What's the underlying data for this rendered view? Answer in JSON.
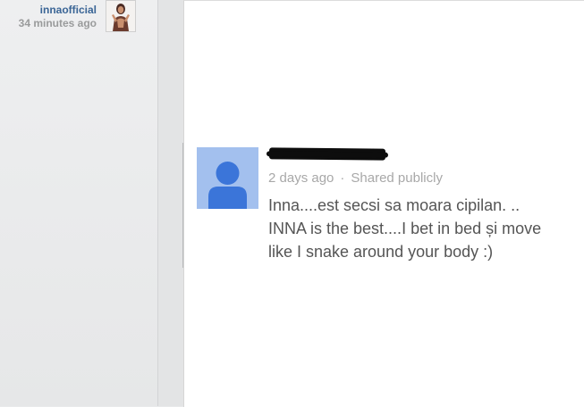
{
  "stream_item": {
    "author_name": "innaofficial",
    "time_ago": "34 minutes ago"
  },
  "comment": {
    "meta_time": "2 days ago",
    "meta_separator": "·",
    "meta_visibility": "Shared publicly",
    "body_lines": [
      "Inna....est secsi sa moara cipilan. ..",
      "INNA is the best....I bet in bed și move",
      "like I snake around your body :)"
    ]
  },
  "colors": {
    "author_link": "#3a6596",
    "default_avatar_bg": "#a3c0ee",
    "default_avatar_fg": "#3b75d9",
    "comment_text": "#555555",
    "meta_text": "#a8a8a8"
  },
  "icons": {
    "default_avatar": "person-silhouette-icon"
  }
}
